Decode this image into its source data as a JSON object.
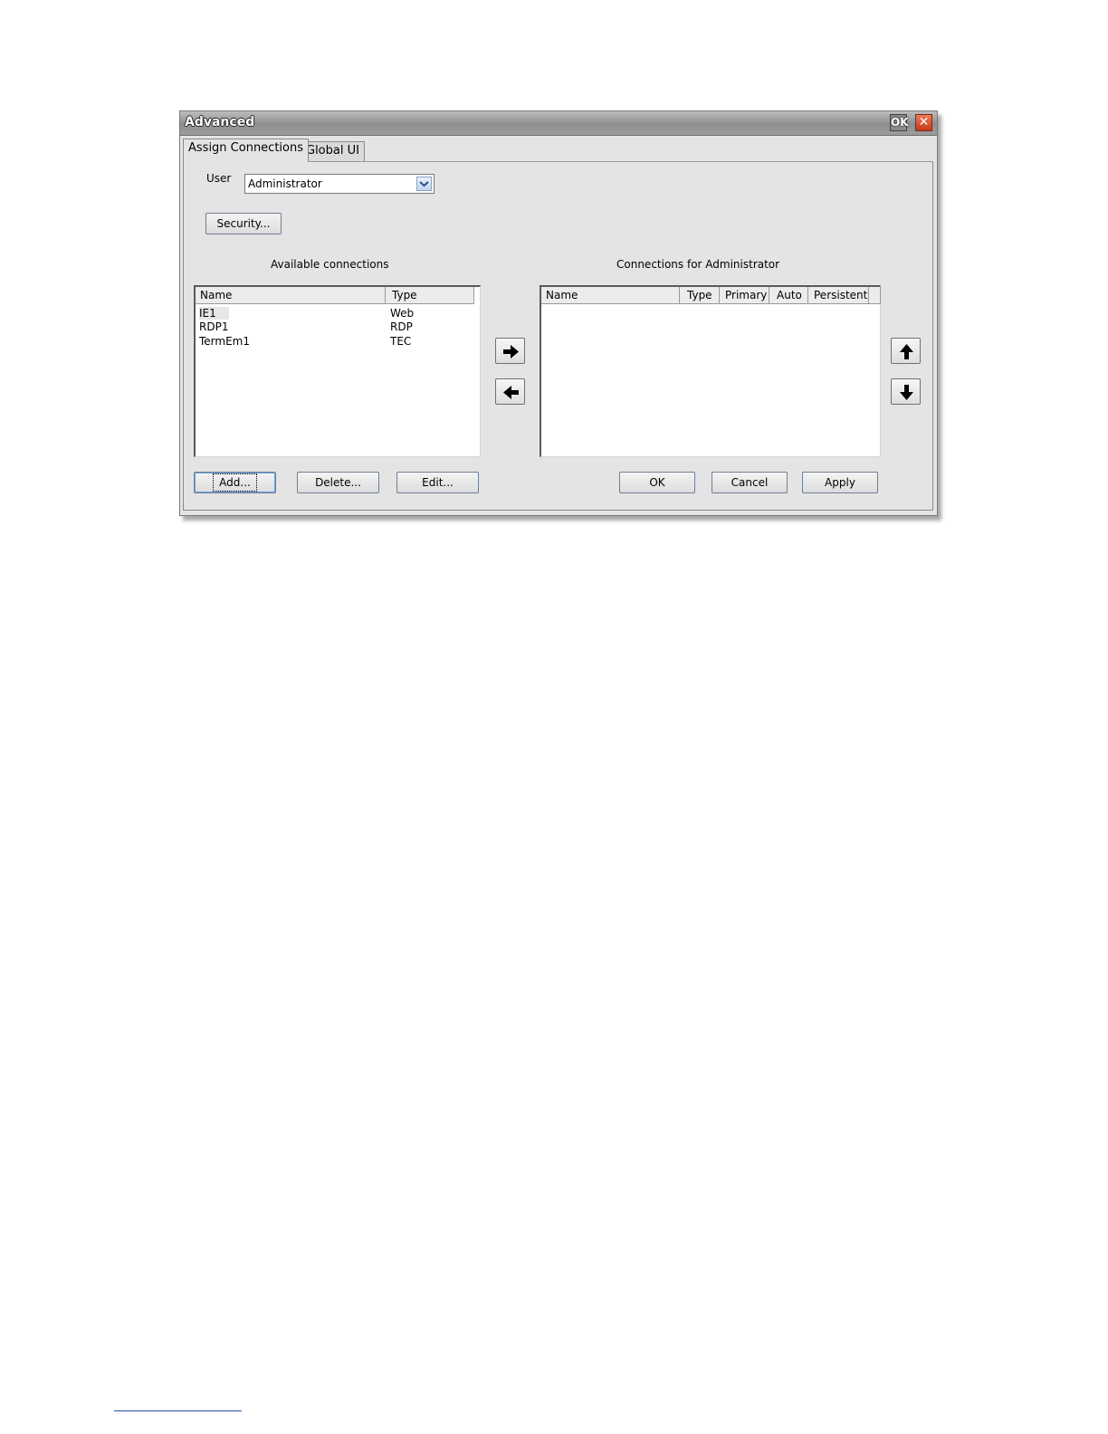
{
  "window": {
    "title": "Advanced",
    "ok_label": "OK",
    "close_label": "✕"
  },
  "tabs": [
    {
      "label": "Assign Connections"
    },
    {
      "label": "Global UI"
    }
  ],
  "user": {
    "label": "User",
    "value": "Administrator"
  },
  "security_button": "Security...",
  "available": {
    "heading": "Available connections",
    "columns": [
      "Name",
      "Type"
    ],
    "rows": [
      {
        "name": "IE1",
        "type": "Web"
      },
      {
        "name": "RDP1",
        "type": "RDP"
      },
      {
        "name": "TermEm1",
        "type": "TEC"
      }
    ]
  },
  "assigned": {
    "heading": "Connections for Administrator",
    "columns": [
      "Name",
      "Type",
      "Primary",
      "Auto",
      "Persistent"
    ],
    "rows": []
  },
  "buttons": {
    "add": "Add...",
    "delete": "Delete...",
    "edit": "Edit...",
    "ok": "OK",
    "cancel": "Cancel",
    "apply": "Apply"
  },
  "icons": {
    "move_right": "arrow-right-icon",
    "move_left": "arrow-left-icon",
    "move_up": "arrow-up-icon",
    "move_down": "arrow-down-icon",
    "dropdown": "chevron-down-icon"
  }
}
